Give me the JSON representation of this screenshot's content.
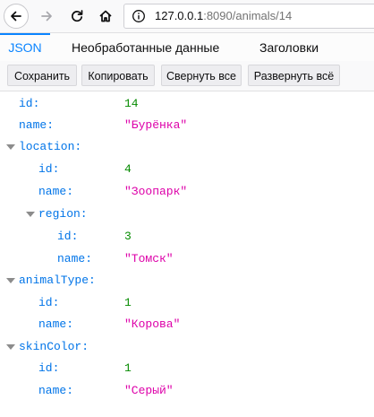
{
  "browser": {
    "url_host": "127.0.0.1",
    "url_rest": ":8090/animals/14"
  },
  "tabs": {
    "json": "JSON",
    "raw": "Необработанные данные",
    "headers": "Заголовки"
  },
  "actions": {
    "save": "Сохранить",
    "copy": "Копировать",
    "collapse": "Свернуть все",
    "expand": "Развернуть всё"
  },
  "json": {
    "id_key": "id:",
    "id_val": "14",
    "name_key": "name:",
    "name_val": "\"Бурёнка\"",
    "location": {
      "key": "location:",
      "id_key": "id:",
      "id_val": "4",
      "name_key": "name:",
      "name_val": "\"Зоопарк\"",
      "region": {
        "key": "region:",
        "id_key": "id:",
        "id_val": "3",
        "name_key": "name:",
        "name_val": "\"Томск\""
      }
    },
    "animalType": {
      "key": "animalType:",
      "id_key": "id:",
      "id_val": "1",
      "name_key": "name:",
      "name_val": "\"Корова\""
    },
    "skinColor": {
      "key": "skinColor:",
      "id_key": "id:",
      "id_val": "1",
      "name_key": "name:",
      "name_val": "\"Серый\""
    }
  }
}
